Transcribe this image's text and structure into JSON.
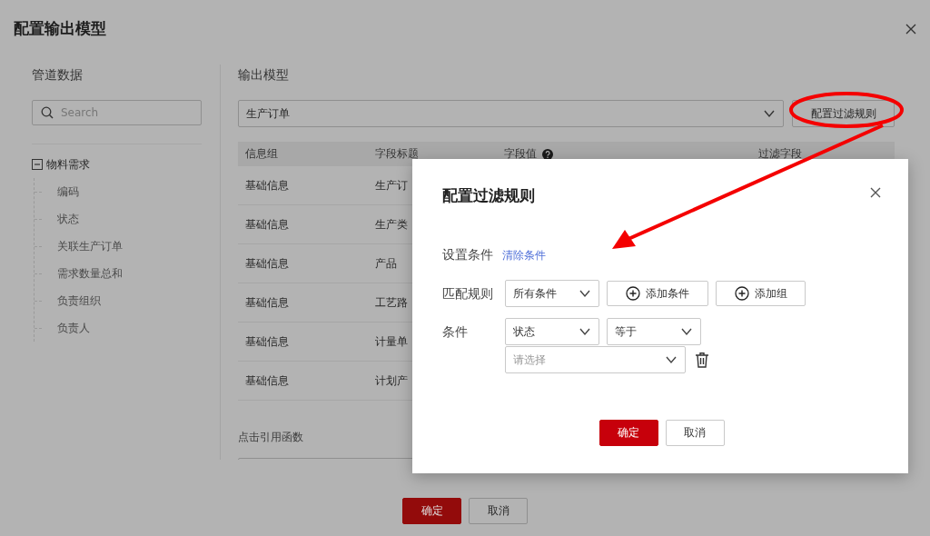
{
  "dialog": {
    "title": "配置输出模型"
  },
  "pipeline": {
    "title": "管道数据",
    "search": {
      "placeholder": "Search"
    },
    "tree": [
      {
        "label": "物料需求",
        "expanded": true,
        "children": [
          {
            "label": "编码"
          },
          {
            "label": "状态"
          },
          {
            "label": "关联生产订单"
          },
          {
            "label": "需求数量总和"
          },
          {
            "label": "负责组织"
          },
          {
            "label": "负责人"
          }
        ]
      }
    ]
  },
  "output_model": {
    "title": "输出模型",
    "model_select": {
      "value": "生产订单"
    },
    "filter_button": "配置过滤规则",
    "table": {
      "columns": [
        {
          "label": "信息组",
          "help": false
        },
        {
          "label": "字段标题",
          "help": false
        },
        {
          "label": "字段值",
          "help": true
        },
        {
          "label": "过滤字段",
          "help": false
        }
      ],
      "rows": [
        [
          "基础信息",
          "生产订"
        ],
        [
          "基础信息",
          "生产类"
        ],
        [
          "基础信息",
          "产品"
        ],
        [
          "基础信息",
          "工艺路"
        ],
        [
          "基础信息",
          "计量单"
        ],
        [
          "基础信息",
          "计划产"
        ]
      ]
    },
    "function_label": "点击引用函数"
  },
  "footer_buttons": [
    {
      "label": "确定",
      "kind": "primary"
    },
    {
      "label": "取消",
      "kind": "secondary"
    }
  ],
  "filter_modal": {
    "title": "配置过滤规则",
    "conditions_label": "设置条件",
    "clear_link": "清除条件",
    "match_label": "匹配规则",
    "match_select": {
      "value": "所有条件"
    },
    "add_buttons": [
      "添加条件",
      "添加组"
    ],
    "condition_label": "条件",
    "field_select": {
      "value": "状态"
    },
    "operator_select": {
      "value": "等于"
    },
    "value_select": {
      "placeholder": "请选择"
    },
    "buttons": [
      {
        "label": "确定",
        "kind": "primary"
      },
      {
        "label": "取消",
        "kind": "secondary"
      }
    ]
  }
}
